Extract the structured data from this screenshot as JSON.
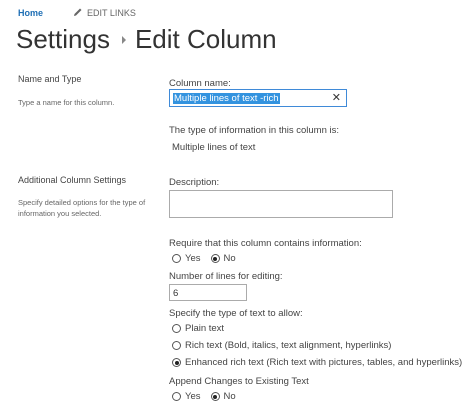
{
  "nav": {
    "home": "Home",
    "edit_links": "EDIT LINKS"
  },
  "breadcrumb": {
    "parent": "Settings",
    "current": "Edit Column"
  },
  "sections": {
    "name_type": {
      "title": "Name and Type",
      "description": "Type a name for this column."
    },
    "additional": {
      "title": "Additional Column Settings",
      "description": "Specify detailed options for the type of information you selected."
    }
  },
  "form": {
    "column_name_label": "Column name:",
    "column_name_value": "Multiple lines of text -rich",
    "clear_glyph": "✕",
    "type_info_label": "The type of information in this column is:",
    "type_info_value": "Multiple lines of text",
    "description_label": "Description:",
    "description_value": "",
    "require_label": "Require that this column contains information:",
    "require_options": [
      "Yes",
      "No"
    ],
    "require_selected": "No",
    "lines_label": "Number of lines for editing:",
    "lines_value": "6",
    "text_type_label": "Specify the type of text to allow:",
    "text_type_options": [
      "Plain text",
      "Rich text (Bold, italics, text alignment, hyperlinks)",
      "Enhanced rich text (Rich text with pictures, tables, and hyperlinks)"
    ],
    "text_type_selected": "Enhanced rich text (Rich text with pictures, tables, and hyperlinks)",
    "append_label": "Append Changes to Existing Text",
    "append_options": [
      "Yes",
      "No"
    ],
    "append_selected": "No"
  },
  "colors": {
    "link": "#1f6fb5",
    "selection": "#3393df",
    "focus_border": "#3f8ad8"
  }
}
